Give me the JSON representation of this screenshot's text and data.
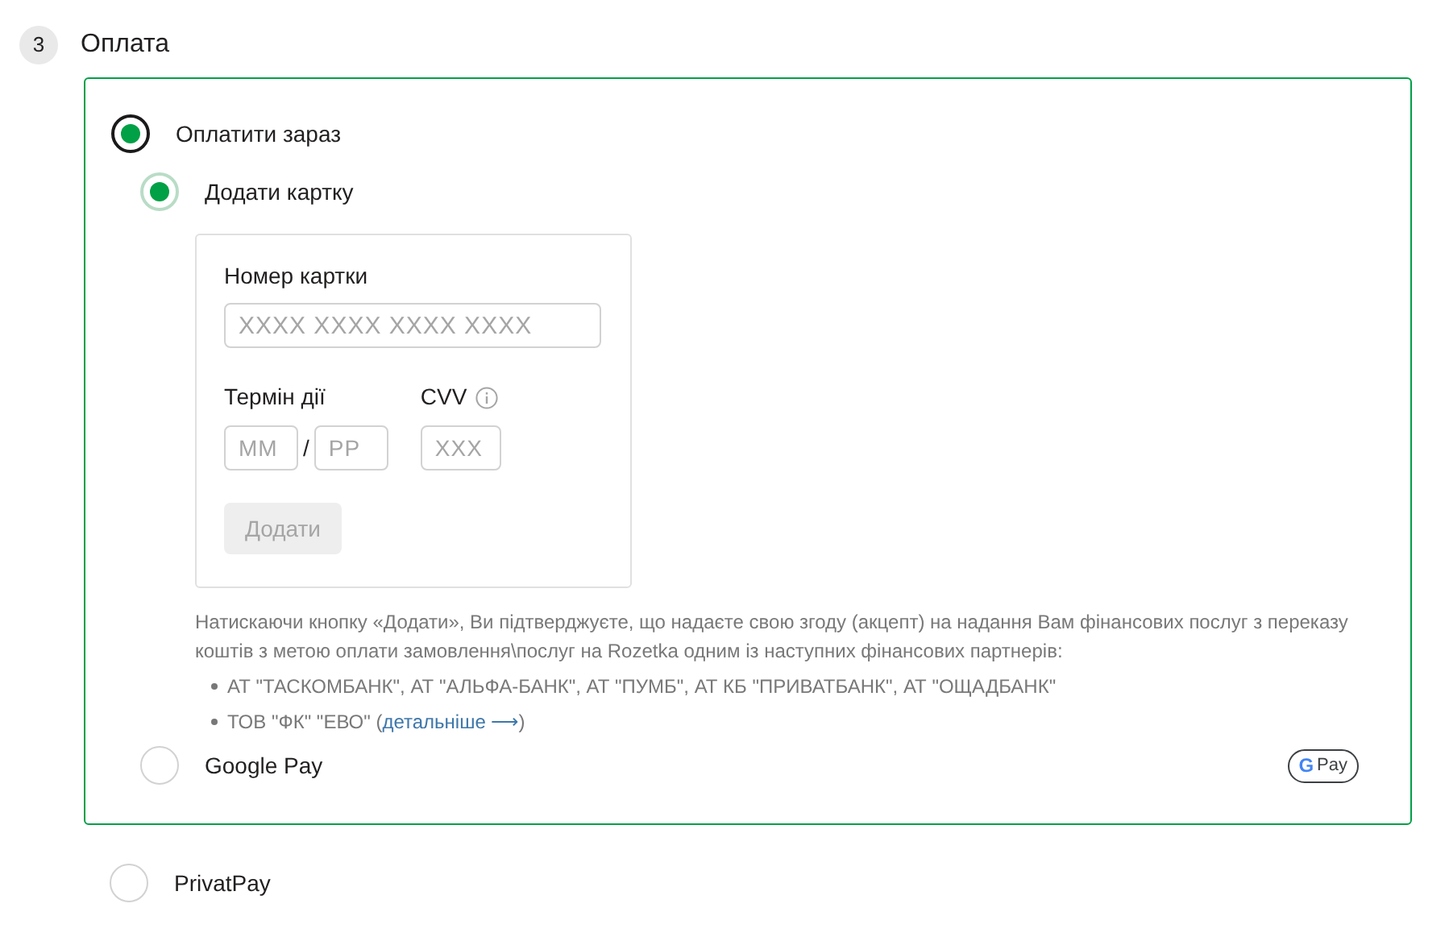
{
  "step": {
    "number": "3",
    "title": "Оплата"
  },
  "payment_options": [
    {
      "label": "Оплатити зараз",
      "selected": true,
      "sub_options": [
        {
          "label": "Додати картку",
          "selected": true,
          "card_form": {
            "number_label": "Номер картки",
            "number_placeholder": "XXXX XXXX XXXX XXXX",
            "expiry_label": "Термін дії",
            "month_placeholder": "ММ",
            "separator": "/",
            "year_placeholder": "РР",
            "cvv_label": "CVV",
            "cvv_placeholder": "XXX",
            "submit": "Додати",
            "submit_disabled": true
          },
          "consent": {
            "text": "Натискаючи кнопку «Додати», Ви підтверджуєте, що надаєте свою згоду (акцепт) на надання Вам фінансових послуг з переказу коштів з метою оплати замовлення\\послуг на Rozetka одним із наступних фінансових партнерів:",
            "partners": [
              {
                "text": "АТ \"ТАСКОМБАНК\", АТ \"АЛЬФА-БАНК\", АТ \"ПУМБ\", АТ КБ \"ПРИВАТБАНК\", АТ \"ОЩАДБАНК\""
              },
              {
                "text": "ТОВ \"ФК\" \"ЕВО\" (",
                "link": "детальніше ⟶",
                "after": ")"
              }
            ]
          }
        },
        {
          "label": "Google Pay",
          "selected": false,
          "badge": {
            "logo": "G",
            "text": "Pay"
          }
        }
      ]
    },
    {
      "label": "PrivatPay",
      "selected": false
    }
  ]
}
